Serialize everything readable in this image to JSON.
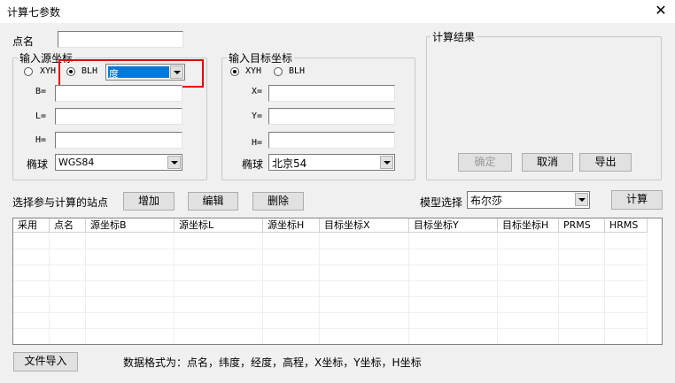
{
  "window": {
    "title": "计算七参数"
  },
  "point": {
    "label": "点名",
    "value": ""
  },
  "source": {
    "legend": "输入源坐标",
    "opt_xyh": "XYH",
    "opt_blh": "BLH",
    "unit_value": "度",
    "b_label": "B=",
    "l_label": "L=",
    "h_label": "H=",
    "ellipsoid_label": "椭球",
    "ellipsoid_value": "WGS84"
  },
  "target": {
    "legend": "输入目标坐标",
    "opt_xyh": "XYH",
    "opt_blh": "BLH",
    "x_label": "X=",
    "y_label": "Y=",
    "h_label": "H=",
    "ellipsoid_label": "椭球",
    "ellipsoid_value": "北京54"
  },
  "result": {
    "legend": "计算结果",
    "ok_label": "确定",
    "cancel_label": "取消",
    "export_label": "导出"
  },
  "stations": {
    "label": "选择参与计算的站点",
    "add_label": "增加",
    "edit_label": "编辑",
    "delete_label": "删除",
    "model_label": "模型选择",
    "model_value": "布尔莎",
    "compute_label": "计算"
  },
  "table": {
    "columns": [
      "采用",
      "点名",
      "源坐标B",
      "源坐标L",
      "源坐标H",
      "目标坐标X",
      "目标坐标Y",
      "目标坐标H",
      "PRMS",
      "HRMS"
    ]
  },
  "footer": {
    "import_label": "文件导入",
    "format_text": "数据格式为：点名，纬度，经度，高程，X坐标，Y坐标，H坐标"
  },
  "colors": {
    "highlight": "#0078d7",
    "annotation": "#e60000"
  }
}
